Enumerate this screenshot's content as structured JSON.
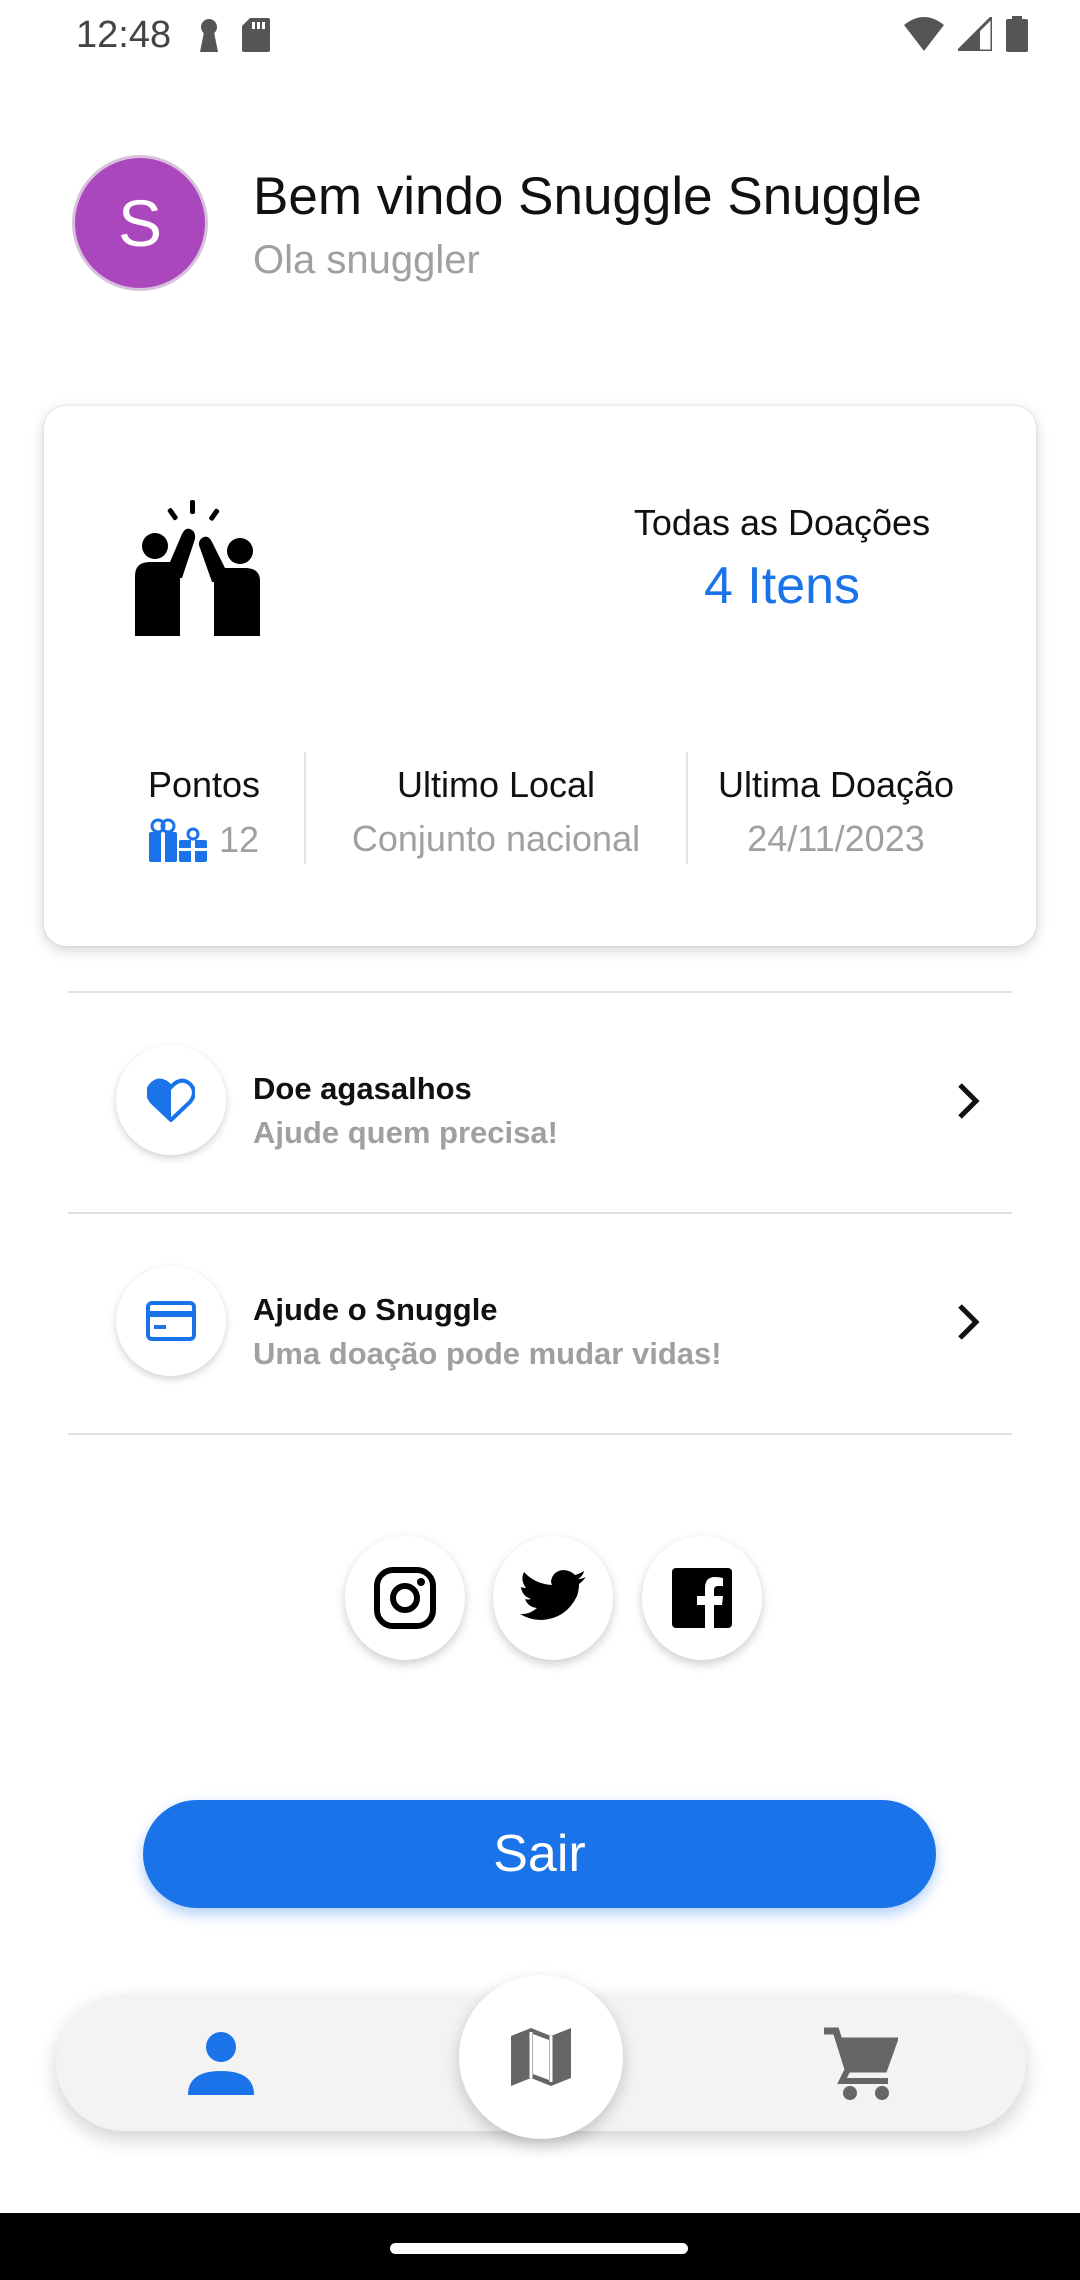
{
  "status_bar": {
    "time": "12:48"
  },
  "header": {
    "avatar_initial": "S",
    "title": "Bem vindo Snuggle Snuggle",
    "subtitle": "Ola snuggler"
  },
  "summary_card": {
    "all_donations_label": "Todas as Doações",
    "all_donations_value": "4 Itens",
    "stats": {
      "points_label": "Pontos",
      "points_value": "12",
      "last_place_label": "Ultimo Local",
      "last_place_value": "Conjunto nacional",
      "last_donation_label": "Ultima Doação",
      "last_donation_value": "24/11/2023"
    }
  },
  "menu": [
    {
      "title": "Doe agasalhos",
      "subtitle": "Ajude quem precisa!",
      "icon": "heart-icon"
    },
    {
      "title": "Ajude o Snuggle",
      "subtitle": "Uma doação pode mudar vidas!",
      "icon": "credit-card-icon"
    }
  ],
  "social": [
    "instagram-icon",
    "twitter-icon",
    "facebook-icon"
  ],
  "logout_label": "Sair",
  "bottom_nav": {
    "items": [
      "profile-icon",
      "map-icon",
      "cart-icon"
    ],
    "active": "profile-icon"
  },
  "colors": {
    "accent": "#1a73e8",
    "avatar": "#ab47bc",
    "muted_text": "#a0a0a0"
  }
}
